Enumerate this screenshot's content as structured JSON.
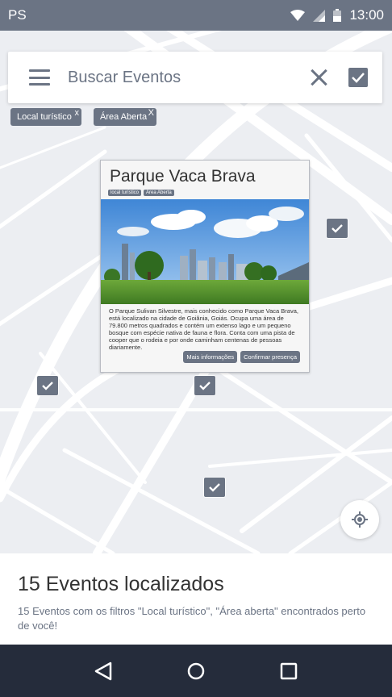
{
  "status_bar": {
    "carrier": "PS",
    "time": "13:00"
  },
  "search": {
    "placeholder": "Buscar Eventos",
    "value": ""
  },
  "filters": [
    {
      "label": "Local turístico",
      "close": "x"
    },
    {
      "label": "Área Aberta",
      "close": "X"
    }
  ],
  "popup": {
    "title": "Parque Vaca Brava",
    "tags": [
      "local turístico",
      "Área Aberta"
    ],
    "description": "O Parque Sulivan Silvestre, mais conhecido como Parque Vaca Brava, está localizado na cidade de Goiânia, Goiás. Ocupa uma área de 79.800 metros quadrados e contém um extenso lago e um pequeno bosque com espécie nativa de fauna e flora. Conta com uma pista de cooper que o rodeia e por onde caminham centenas de pessoas diariamente.",
    "more_info_label": "Mais informações",
    "confirm_label": "Confirmar presença"
  },
  "results": {
    "title": "15 Eventos localizados",
    "description": "15 Eventos com os filtros \"Local turístico\", \"Área aberta\" encontrados perto de você!"
  },
  "icons": {
    "wifi": "wifi-icon",
    "signal": "signal-icon",
    "battery": "battery-icon",
    "menu": "menu-icon",
    "clear": "close-icon",
    "confirm": "checkbox-icon",
    "locate": "my-location-icon",
    "back": "back-icon",
    "home": "home-icon",
    "recents": "recents-icon"
  },
  "colors": {
    "accent": "#6b7484",
    "nav_bar": "#252c3b",
    "map_bg": "#eceef2",
    "road": "#ffffff"
  }
}
